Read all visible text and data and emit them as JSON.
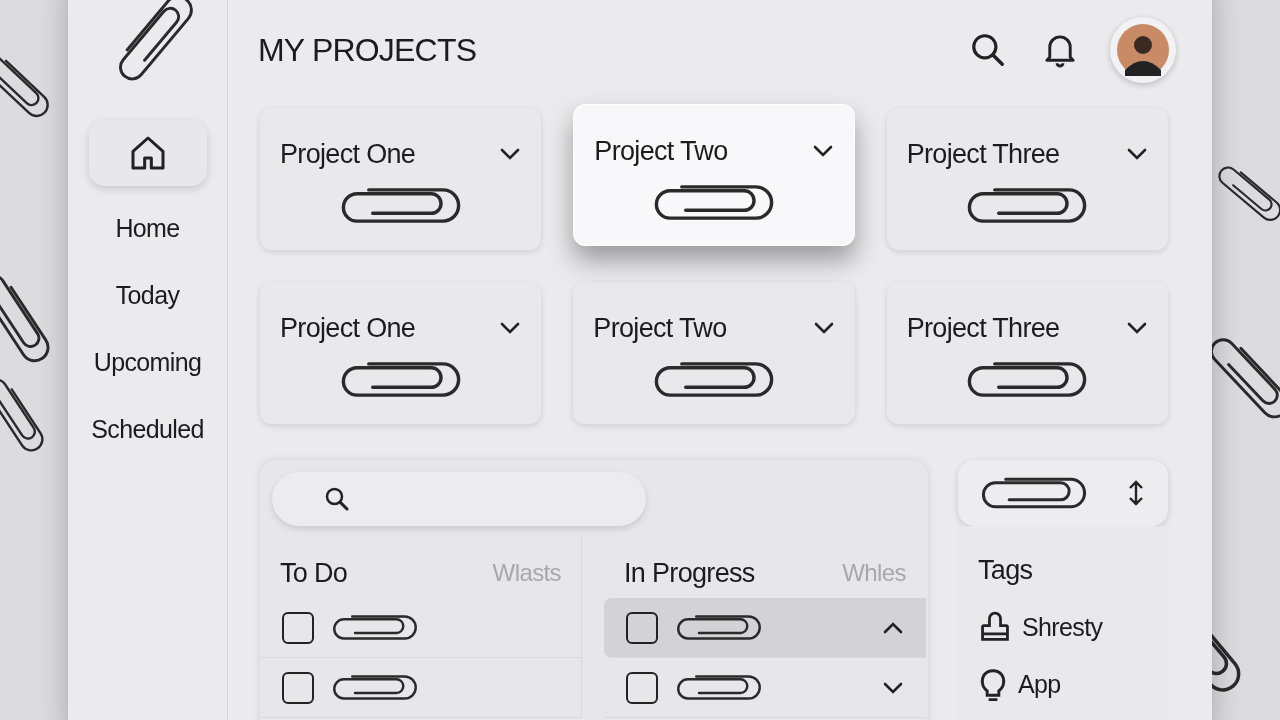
{
  "header": {
    "title": "MY PROJECTS"
  },
  "sidebar": {
    "items": [
      {
        "label": "Home"
      },
      {
        "label": "Today"
      },
      {
        "label": "Upcoming"
      },
      {
        "label": "Scheduled"
      }
    ]
  },
  "projects": [
    {
      "title": "Project One",
      "selected": false
    },
    {
      "title": "Project Two",
      "selected": true
    },
    {
      "title": "Project Three",
      "selected": false
    },
    {
      "title": "Project One",
      "selected": false
    },
    {
      "title": "Project Two",
      "selected": false
    },
    {
      "title": "Project Three",
      "selected": false
    }
  ],
  "board": {
    "columns": [
      {
        "title": "To Do",
        "note": "Wlasts",
        "tasks": [
          {
            "checked": false,
            "selected": false
          },
          {
            "checked": false,
            "selected": false
          }
        ]
      },
      {
        "title": "In Progress",
        "note": "Whles",
        "tasks": [
          {
            "checked": false,
            "selected": true,
            "expanded": true
          },
          {
            "checked": false,
            "selected": false,
            "expanded": false
          }
        ]
      }
    ]
  },
  "tags": {
    "title": "Tags",
    "items": [
      {
        "kind": "person",
        "label": "Shresty"
      },
      {
        "kind": "idea",
        "label": "App"
      }
    ]
  }
}
